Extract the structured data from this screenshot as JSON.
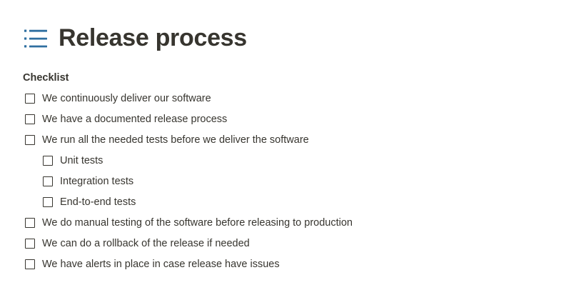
{
  "page": {
    "title": "Release process",
    "title_icon": "bulleted-list-icon",
    "accent_color": "#2f6fa0"
  },
  "checklist": {
    "heading": "Checklist",
    "items": [
      {
        "label": "We continuously deliver our software",
        "checked": false,
        "level": 0
      },
      {
        "label": "We have a documented release process",
        "checked": false,
        "level": 0
      },
      {
        "label": "We run all the needed tests before we deliver the software",
        "checked": false,
        "level": 0
      },
      {
        "label": "Unit tests",
        "checked": false,
        "level": 1
      },
      {
        "label": "Integration tests",
        "checked": false,
        "level": 1
      },
      {
        "label": "End-to-end tests",
        "checked": false,
        "level": 1
      },
      {
        "label": "We do manual testing of the software before releasing to production",
        "checked": false,
        "level": 0
      },
      {
        "label": "We can do a rollback of the release if needed",
        "checked": false,
        "level": 0
      },
      {
        "label": "We have alerts in place in case release have issues",
        "checked": false,
        "level": 0
      }
    ]
  }
}
